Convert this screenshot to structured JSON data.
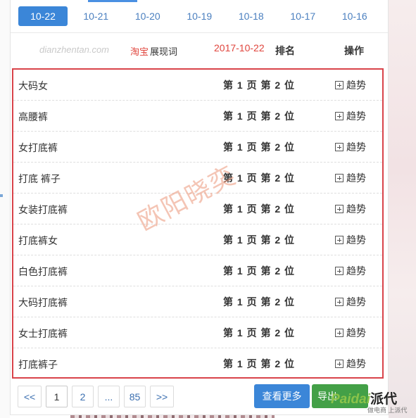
{
  "tabs": [
    {
      "label": "10-22",
      "active": true
    },
    {
      "label": "10-21"
    },
    {
      "label": "10-20"
    },
    {
      "label": "10-19"
    },
    {
      "label": "10-18"
    },
    {
      "label": "10-17"
    },
    {
      "label": "10-16"
    }
  ],
  "header": {
    "site": "dianzhentan.com",
    "platform": "淘宝",
    "label": "展现词",
    "date": "2017-10-22",
    "rank_col": "排名",
    "op_col": "操作"
  },
  "rows": [
    {
      "keyword": "大码女",
      "rank": "第 1 页 第 2 位",
      "action": "趋势"
    },
    {
      "keyword": "高腰裤",
      "rank": "第 1 页 第 2 位",
      "action": "趋势"
    },
    {
      "keyword": "女打底裤",
      "rank": "第 1 页 第 2 位",
      "action": "趋势"
    },
    {
      "keyword": "打底 裤子",
      "rank": "第 1 页 第 2 位",
      "action": "趋势"
    },
    {
      "keyword": "女装打底裤",
      "rank": "第 1 页 第 2 位",
      "action": "趋势"
    },
    {
      "keyword": "打底裤女",
      "rank": "第 1 页 第 2 位",
      "action": "趋势"
    },
    {
      "keyword": "白色打底裤",
      "rank": "第 1 页 第 2 位",
      "action": "趋势"
    },
    {
      "keyword": "大码打底裤",
      "rank": "第 1 页 第 2 位",
      "action": "趋势"
    },
    {
      "keyword": "女士打底裤",
      "rank": "第 1 页 第 2 位",
      "action": "趋势"
    },
    {
      "keyword": "打底裤子",
      "rank": "第 1 页 第 2 位",
      "action": "趋势"
    }
  ],
  "watermark": "欧阳晓奕",
  "pagination": {
    "prev": "<<",
    "pages": [
      "1",
      "2",
      "...",
      "85"
    ],
    "current": "1",
    "next": ">>"
  },
  "buttons": {
    "more": "查看更多",
    "export": "导出"
  },
  "logo": {
    "brand_latin": "Paidai",
    "brand_cn": "派代",
    "tagline": "做电商 上派代"
  },
  "colors": {
    "accent": "#3b86d8",
    "highlight_border": "#d9434a",
    "date_red": "#e0453d",
    "export_green": "#43a047"
  },
  "icons": {
    "trend": "plus-square-icon"
  }
}
